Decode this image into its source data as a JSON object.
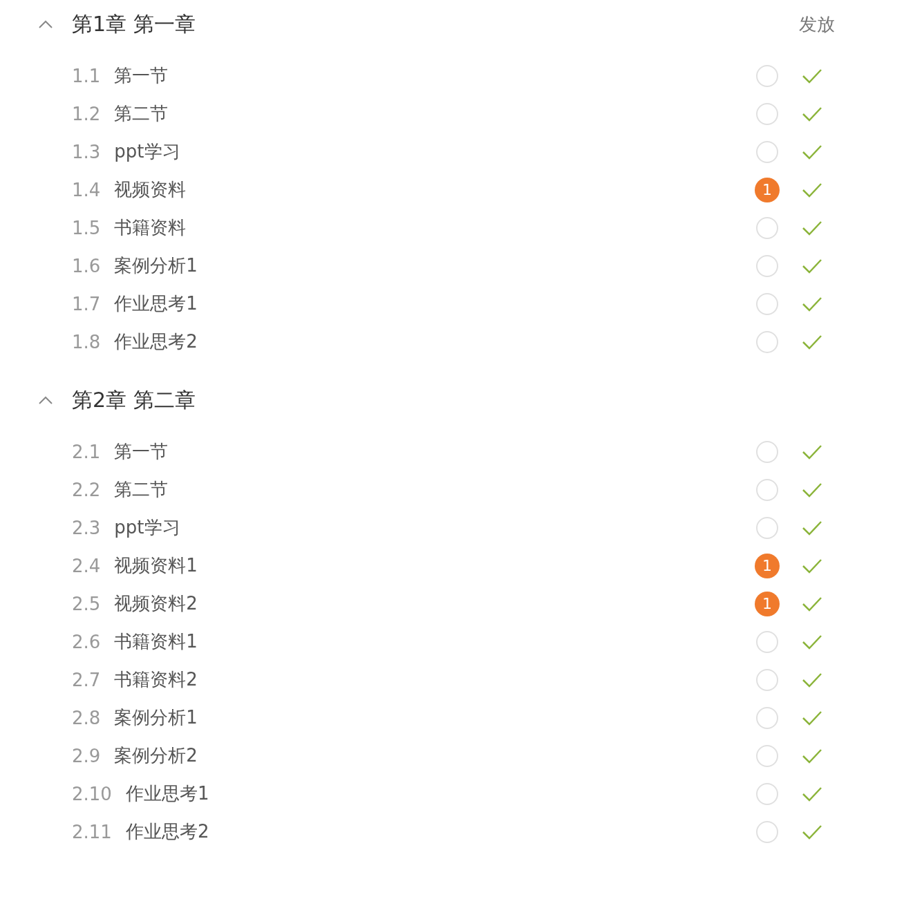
{
  "chapters": [
    {
      "title": "第1章 第一章",
      "expanded": true,
      "column_label": "发放",
      "sections": [
        {
          "number": "1.1",
          "title": "第一节",
          "published": true
        },
        {
          "number": "1.2",
          "title": "第二节",
          "published": true
        },
        {
          "number": "1.3",
          "title": "ppt学习",
          "published": true
        },
        {
          "number": "1.4",
          "title": "视频资料",
          "badge": "1",
          "published": true
        },
        {
          "number": "1.5",
          "title": "书籍资料",
          "published": true
        },
        {
          "number": "1.6",
          "title": "案例分析1",
          "published": true
        },
        {
          "number": "1.7",
          "title": "作业思考1",
          "published": true
        },
        {
          "number": "1.8",
          "title": "作业思考2",
          "published": true
        }
      ]
    },
    {
      "title": "第2章 第二章",
      "expanded": true,
      "sections": [
        {
          "number": "2.1",
          "title": "第一节",
          "published": true
        },
        {
          "number": "2.2",
          "title": "第二节",
          "published": true
        },
        {
          "number": "2.3",
          "title": "ppt学习",
          "published": true
        },
        {
          "number": "2.4",
          "title": "视频资料1",
          "badge": "1",
          "published": true
        },
        {
          "number": "2.5",
          "title": "视频资料2",
          "badge": "1",
          "published": true
        },
        {
          "number": "2.6",
          "title": "书籍资料1",
          "published": true
        },
        {
          "number": "2.7",
          "title": "书籍资料2",
          "published": true
        },
        {
          "number": "2.8",
          "title": "案例分析1",
          "published": true
        },
        {
          "number": "2.9",
          "title": "案例分析2",
          "published": true
        },
        {
          "number": "2.10",
          "title": "作业思考1",
          "published": true
        },
        {
          "number": "2.11",
          "title": "作业思考2",
          "published": true
        }
      ]
    }
  ]
}
